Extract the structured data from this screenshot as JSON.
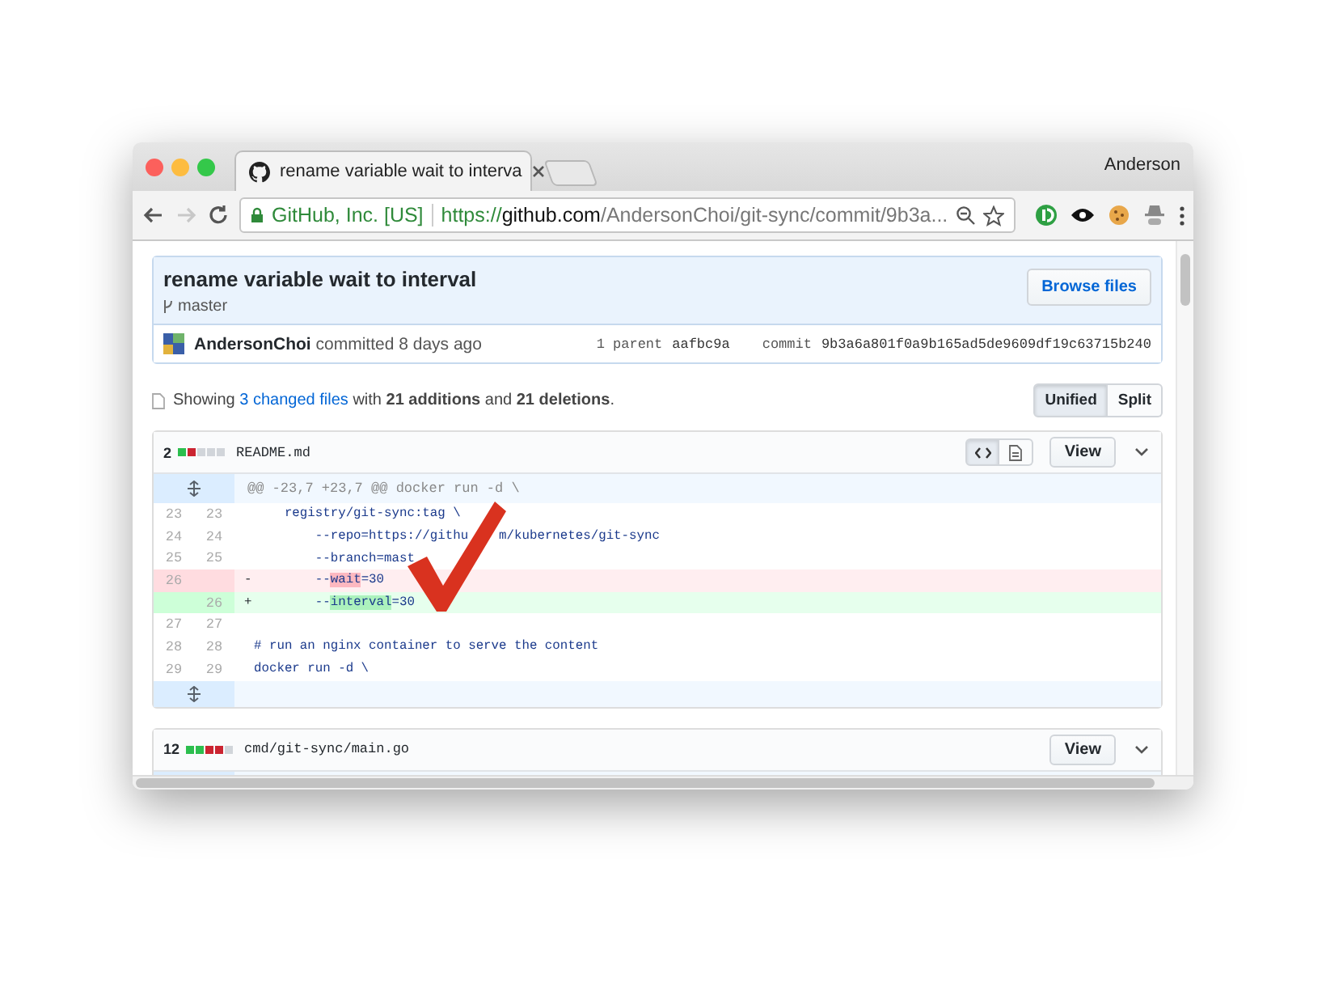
{
  "browser": {
    "profile": "Anderson",
    "tabs": [
      {
        "title": "rename variable wait to interva",
        "selected": true
      }
    ],
    "nav": {
      "back_disabled": false,
      "forward_disabled": true
    },
    "address": {
      "identity": "GitHub, Inc. [US]",
      "scheme": "https://",
      "host": "github.com",
      "path": "/AndersonChoi/git-sync/commit/9b3a..."
    }
  },
  "commit": {
    "title": "rename variable wait to interval",
    "branch": "master",
    "browse_button": "Browse files",
    "author": "AndersonChoi",
    "action": "committed 8 days ago",
    "parent_label": "1 parent",
    "parent": "aafbc9a",
    "commit_label": "commit",
    "sha": "9b3a6a801f0a9b165ad5de9609df19c63715b240"
  },
  "summary": {
    "prefix": "Showing",
    "link": "3 changed files",
    "rest": "with **21 additions** and **21 deletions**."
  },
  "view_toggle": [
    {
      "label": "Unified",
      "selected": true
    },
    {
      "label": "Split",
      "selected": false
    }
  ],
  "files": [
    {
      "count": "2",
      "blocks": [
        {
          "color": "#2cbe4e"
        },
        {
          "color": "#cb2431"
        },
        {
          "color": "#d1d5da"
        },
        {
          "color": "#d1d5da"
        },
        {
          "color": "#d1d5da"
        }
      ],
      "path": "README.md",
      "display_modes": [
        {
          "kind": "code",
          "selected": true
        },
        {
          "kind": "document",
          "selected": false
        }
      ],
      "view_button": "View",
      "hunk": "@@ -23,7 +23,7 @@ docker run -d \\",
      "lines": [
        {
          "kind": "context",
          "old": "23",
          "new": "23",
          "parts": [
            "    registry/git-sync:tag \\"
          ]
        },
        {
          "kind": "context",
          "old": "24",
          "new": "24",
          "parts": [
            "        --repo=https://githu",
            "m/kubernetes/git-sync"
          ]
        },
        {
          "kind": "context",
          "old": "25",
          "new": "25",
          "parts": [
            "        --branch=mast"
          ]
        },
        {
          "kind": "del",
          "old": "26",
          "sign": "-",
          "segments": [
            {
              "text": "        --",
              "highlight": false
            },
            {
              "text": "wait",
              "highlight": true
            },
            {
              "text": "=30",
              "highlight": false
            }
          ]
        },
        {
          "kind": "add",
          "new": "26",
          "sign": "+",
          "segments": [
            {
              "text": "        --",
              "highlight": false
            },
            {
              "text": "interval",
              "highlight": true
            },
            {
              "text": "=30",
              "highlight": false
            }
          ]
        },
        {
          "kind": "context",
          "old": "27",
          "new": "27"
        },
        {
          "kind": "context",
          "old": "28",
          "new": "28",
          "parts": [
            "# run an nginx container to serve the content"
          ]
        },
        {
          "kind": "context",
          "old": "29",
          "new": "29",
          "parts": [
            "docker run -d \\"
          ]
        }
      ]
    },
    {
      "count": "12",
      "blocks": [
        {
          "color": "#2cbe4e"
        },
        {
          "color": "#2cbe4e"
        },
        {
          "color": "#cb2431"
        },
        {
          "color": "#cb2431"
        },
        {
          "color": "#d1d5da"
        }
      ],
      "path": "cmd/git-sync/main.go",
      "view_button": "View"
    }
  ]
}
